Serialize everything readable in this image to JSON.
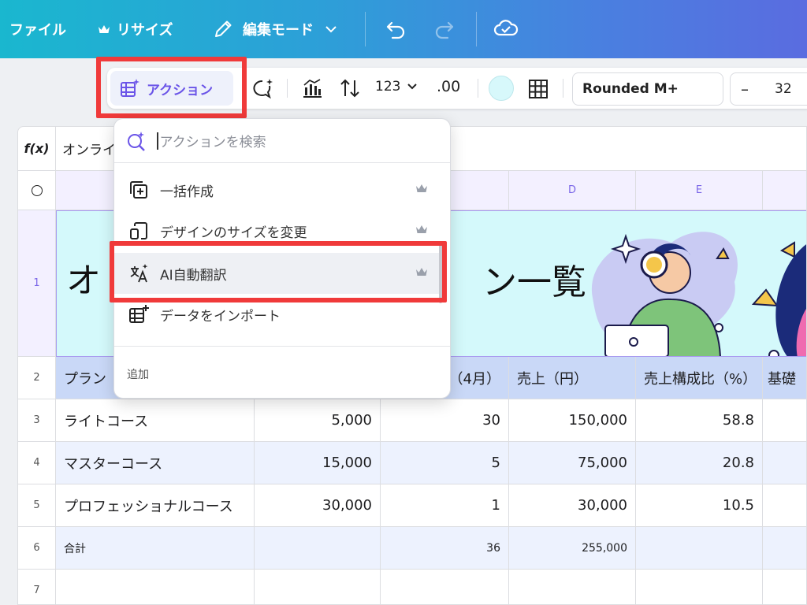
{
  "topbar": {
    "file_label": "ファイル",
    "resize_label": "リサイズ",
    "edit_mode_label": "編集モード"
  },
  "toolbar": {
    "action_label": "アクション",
    "number_format_label": "123",
    "decimal_label": ".00",
    "cell_color": "#d7f8fb",
    "font_name": "Rounded M+",
    "size_minus": "–",
    "font_size": "32"
  },
  "formula_bar": {
    "fx_label": "f(x)",
    "value": "オンライ"
  },
  "columns": [
    "D",
    "E"
  ],
  "rows": [
    "1",
    "2",
    "3",
    "4",
    "5",
    "6",
    "7"
  ],
  "banner": {
    "title_left": "オ",
    "title_right": "ン一覧"
  },
  "table": {
    "header": {
      "col_a": "プラン",
      "col_c": "（4月）",
      "col_d": "売上（円）",
      "col_e": "売上構成比（%）",
      "col_f": "基礎"
    },
    "rows": [
      {
        "plan": "ライトコース",
        "price": "5,000",
        "count": "30",
        "sales": "150,000",
        "ratio": "58.8"
      },
      {
        "plan": "マスターコース",
        "price": "15,000",
        "count": "5",
        "sales": "75,000",
        "ratio": "20.8"
      },
      {
        "plan": "プロフェッショナルコース",
        "price": "30,000",
        "count": "1",
        "sales": "30,000",
        "ratio": "10.5"
      }
    ],
    "total": {
      "label": "合計",
      "count": "36",
      "sales": "255,000"
    }
  },
  "dropdown": {
    "search_placeholder": "アクションを検索",
    "items": [
      {
        "label": "一括作成",
        "icon": "bulk-create-icon"
      },
      {
        "label": "デザインのサイズを変更",
        "icon": "resize-design-icon"
      },
      {
        "label": "AI自動翻訳",
        "icon": "translate-icon"
      },
      {
        "label": "データをインポート",
        "icon": "import-data-icon"
      }
    ],
    "add_section_label": "追加"
  },
  "colors": {
    "accent": "#6b55e8",
    "highlight_box": "#f03a3a"
  }
}
